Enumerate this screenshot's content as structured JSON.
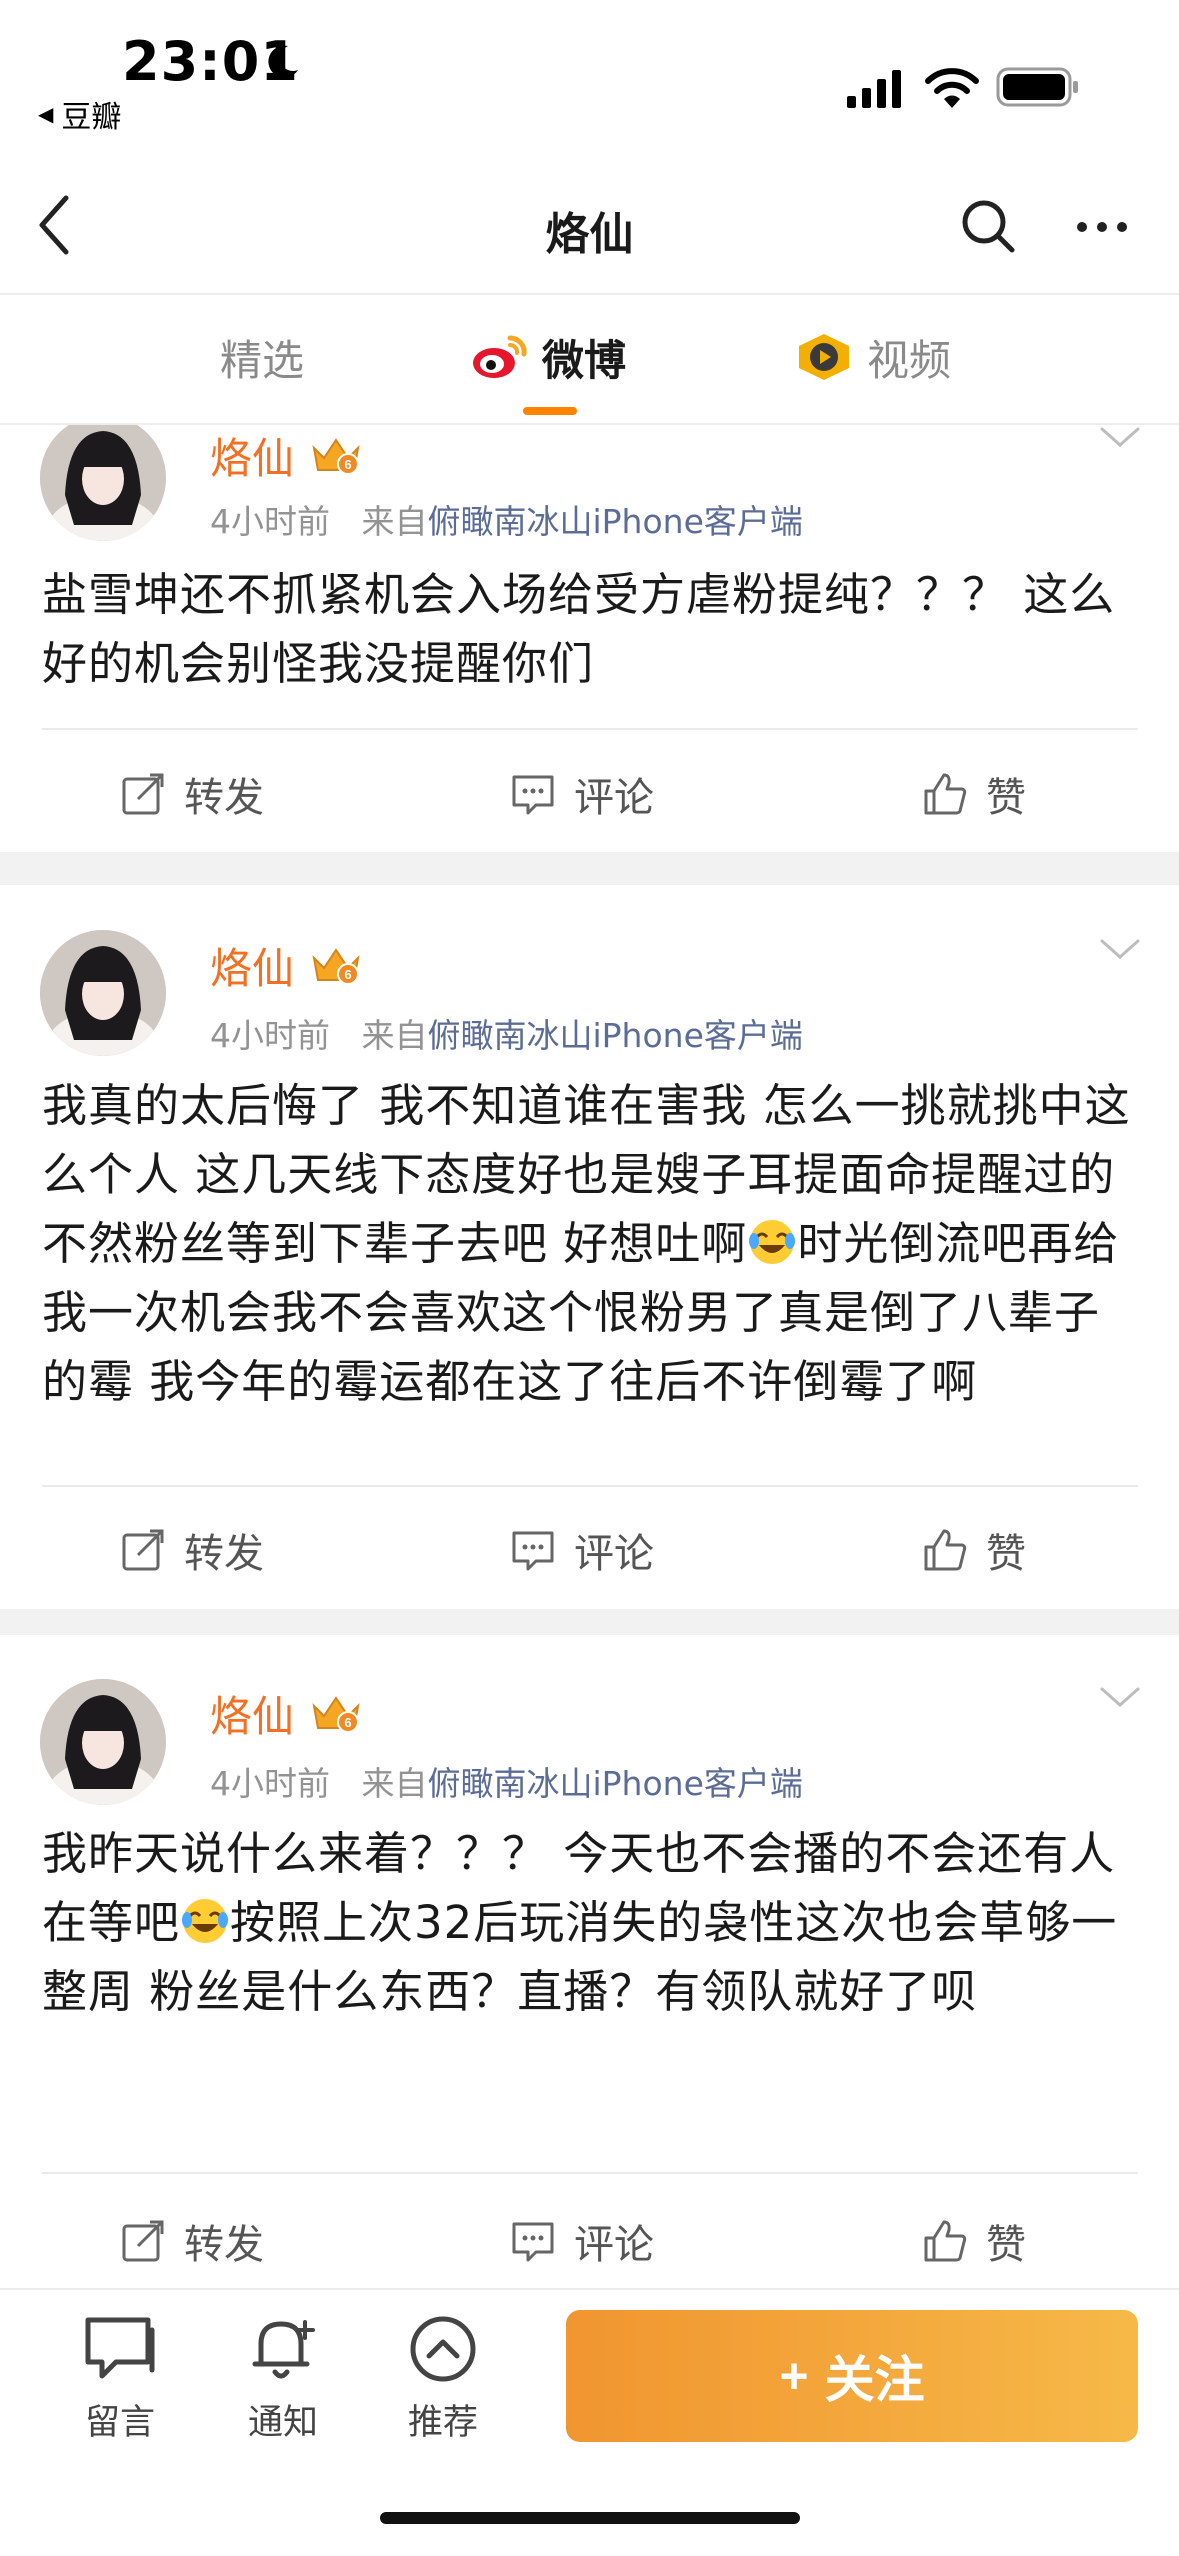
{
  "status_bar": {
    "time": "23:01",
    "back_app": "豆瓣"
  },
  "nav": {
    "title": "烙仙"
  },
  "tabs": [
    {
      "label": "精选"
    },
    {
      "label": "微博"
    },
    {
      "label": "视频"
    }
  ],
  "posts": [
    {
      "author": "烙仙",
      "time": "4小时前",
      "source_prefix": "来自",
      "source": "俯瞰南冰山iPhone客户端",
      "text": "盐雪坤还不抓紧机会入场给受方虐粉提纯？？？ 这么好的机会别怪我没提醒你们",
      "repost": "转发",
      "comment": "评论",
      "like": "赞"
    },
    {
      "author": "烙仙",
      "time": "4小时前",
      "source_prefix": "来自",
      "source": "俯瞰南冰山iPhone客户端",
      "text_before_emoji": "我真的太后悔了 我不知道谁在害我 怎么一挑就挑中这么个人 这几天线下态度好也是嫂子耳提面命提醒过的 不然粉丝等到下辈子去吧 好想吐啊",
      "text_after_emoji": "时光倒流吧再给我一次机会我不会喜欢这个恨粉男了真是倒了八辈子的霉 我今年的霉运都在这了往后不许倒霉了啊",
      "repost": "转发",
      "comment": "评论",
      "like": "赞"
    },
    {
      "author": "烙仙",
      "time": "4小时前",
      "source_prefix": "来自",
      "source": "俯瞰南冰山iPhone客户端",
      "text_before_emoji": "我昨天说什么来着？？？ 今天也不会播的不会还有人在等吧",
      "text_after_emoji": "按照上次32后玩消失的袅性这次也会草够一整周 粉丝是什么东西？直播？有领队就好了呗",
      "repost": "转发",
      "comment": "评论",
      "like": "赞"
    }
  ],
  "bottom_bar": {
    "message": "留言",
    "notify": "通知",
    "recommend": "推荐",
    "follow": "关注",
    "follow_plus": "+"
  },
  "colors": {
    "accent": "#ff8200",
    "author": "#f26f23",
    "source": "#5b6c96",
    "follow_start": "#f19530",
    "follow_end": "#f6b948"
  }
}
